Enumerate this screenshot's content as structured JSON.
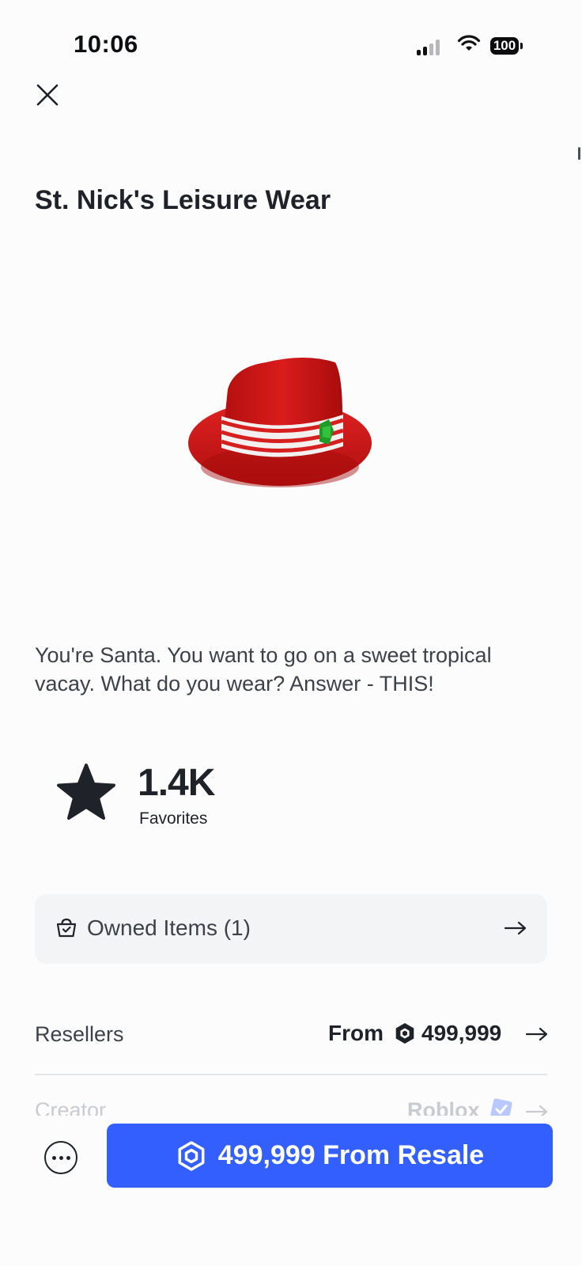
{
  "status_bar": {
    "time": "10:06",
    "battery_level": "100",
    "signal_bars": 2,
    "icons": [
      "signal-icon",
      "wifi-icon",
      "battery-icon"
    ]
  },
  "header": {
    "close_icon": "close-icon"
  },
  "item": {
    "title": "St. Nick's Leisure Wear",
    "description": "You're Santa.  You want to go on a sweet tropical vacay.  What do you wear?  Answer - THIS!",
    "image": "red-fedora-hat"
  },
  "favorites": {
    "count": "1.4K",
    "label": "Favorites",
    "icon": "star-icon"
  },
  "owned_items": {
    "label": "Owned Items (1)",
    "icon": "basket-icon"
  },
  "resellers": {
    "label": "Resellers",
    "from_label": "From",
    "price": "499,999",
    "currency_icon": "robux-icon"
  },
  "creator": {
    "label": "Creator",
    "name": "Roblox",
    "verified": true
  },
  "actions": {
    "more_icon": "more-icon",
    "buy_label": "499,999 From Resale"
  },
  "colors": {
    "accent": "#335fff",
    "text": "#1f2329",
    "secondary_text": "#3d4149",
    "card_bg": "#f3f4f6",
    "hat_red": "#d41a1a"
  }
}
